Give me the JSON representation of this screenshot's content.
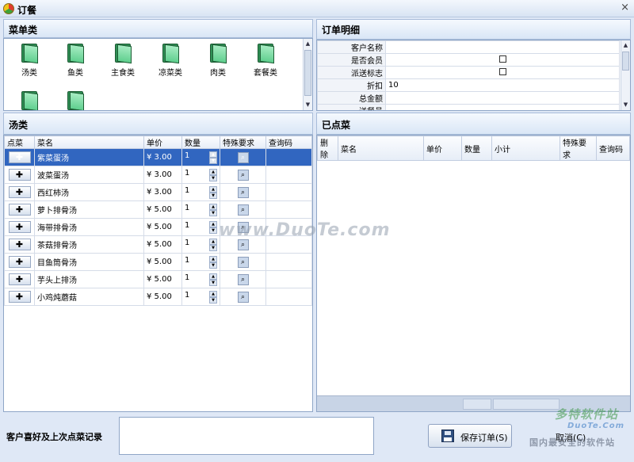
{
  "window": {
    "title": "订餐",
    "close": "×"
  },
  "menu_category": {
    "heading": "菜单类",
    "folders": [
      "汤类",
      "鱼类",
      "主食类",
      "凉菜类",
      "肉类",
      "套餐类",
      "",
      ""
    ]
  },
  "dish_list": {
    "heading": "汤类",
    "columns": [
      "点菜",
      "菜名",
      "单价",
      "数量",
      "特殊要求",
      "查询码"
    ],
    "rows": [
      {
        "name": "紫菜蛋汤",
        "price": "¥ 3.00",
        "qty": "1"
      },
      {
        "name": "波菜蛋汤",
        "price": "¥ 3.00",
        "qty": "1"
      },
      {
        "name": "西红柿汤",
        "price": "¥ 3.00",
        "qty": "1"
      },
      {
        "name": "萝卜排骨汤",
        "price": "¥ 5.00",
        "qty": "1"
      },
      {
        "name": "海带排骨汤",
        "price": "¥ 5.00",
        "qty": "1"
      },
      {
        "name": "茶菇排骨汤",
        "price": "¥ 5.00",
        "qty": "1"
      },
      {
        "name": "目鱼筒骨汤",
        "price": "¥ 5.00",
        "qty": "1"
      },
      {
        "name": "芋头上排汤",
        "price": "¥ 5.00",
        "qty": "1"
      },
      {
        "name": "小鸡炖蘑菇",
        "price": "¥ 5.00",
        "qty": "1"
      }
    ],
    "add_symbol": "✚",
    "search_symbol": "👓"
  },
  "order_detail": {
    "heading": "订单明细",
    "fields": [
      {
        "label": "客户名称",
        "value": ""
      },
      {
        "label": "是否会员",
        "value": ""
      },
      {
        "label": "派送标志",
        "value": ""
      },
      {
        "label": "折扣",
        "value": "10"
      },
      {
        "label": "总金额",
        "value": ""
      },
      {
        "label": "送餐员",
        "value": ""
      }
    ]
  },
  "ordered": {
    "heading": "已点菜",
    "columns": [
      "删除",
      "菜名",
      "单价",
      "数量",
      "小计",
      "特殊要求",
      "查询码"
    ]
  },
  "footer": {
    "preferences_label": "客户喜好及上次点菜记录",
    "save_button": "保存订单(S)",
    "cancel_button": "取消(C)"
  },
  "watermarks": {
    "center": "www.DuoTe.com",
    "corner_brand": "多特软件站",
    "corner_url": "DuoTe.Com",
    "corner_slogan": "国内最安全的软件站"
  }
}
